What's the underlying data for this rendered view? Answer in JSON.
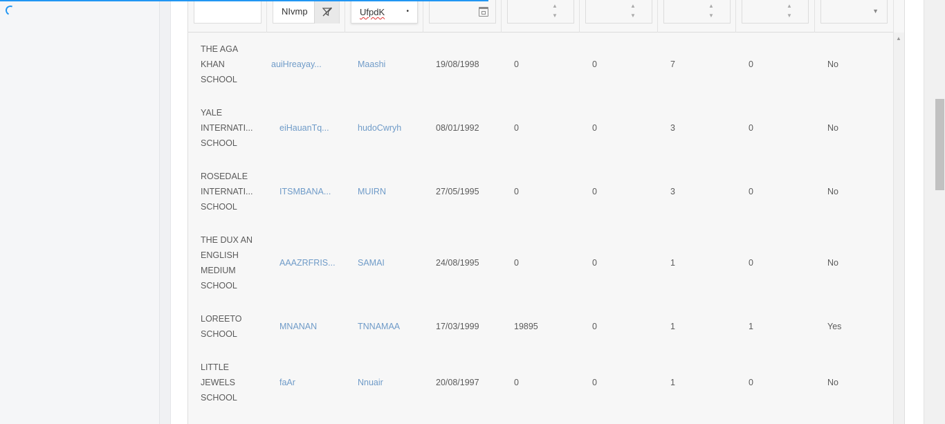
{
  "filters": {
    "col1_value": "",
    "col2_value": "NIvmp",
    "col3_value": "UfpdK",
    "col4_value": "",
    "col5_value": "",
    "col6_value": "",
    "col7_value": "",
    "col8_value": "",
    "col9_value": ""
  },
  "rows": [
    {
      "school": "THE AGA KHAN SCHOOL",
      "code": "auiHreayay...",
      "name": "Maashi",
      "date": "19/08/1998",
      "v1": "0",
      "v2": "0",
      "v3": "7",
      "v4": "0",
      "flag": "No"
    },
    {
      "school": "YALE INTERNATI... SCHOOL",
      "code": "eiHauanTq...",
      "name": "hudoCwryh",
      "date": "08/01/1992",
      "v1": "0",
      "v2": "0",
      "v3": "3",
      "v4": "0",
      "flag": "No"
    },
    {
      "school": "ROSEDALE INTERNATI... SCHOOL",
      "code": "ITSMBANA...",
      "name": "MUIRN",
      "date": "27/05/1995",
      "v1": "0",
      "v2": "0",
      "v3": "3",
      "v4": "0",
      "flag": "No"
    },
    {
      "school": "THE DUX AN ENGLISH MEDIUM SCHOOL",
      "code": "AAAZRFRIS...",
      "name": "SAMAI",
      "date": "24/08/1995",
      "v1": "0",
      "v2": "0",
      "v3": "1",
      "v4": "0",
      "flag": "No"
    },
    {
      "school": "LOREETO SCHOOL",
      "code": "MNANAN",
      "name": "TNNAMAA",
      "date": "17/03/1999",
      "v1": "19895",
      "v2": "0",
      "v3": "1",
      "v4": "1",
      "flag": "Yes"
    },
    {
      "school": "LITTLE JEWELS SCHOOL",
      "code": "faAr",
      "name": "Nnuair",
      "date": "20/08/1997",
      "v1": "0",
      "v2": "0",
      "v3": "1",
      "v4": "0",
      "flag": "No"
    }
  ],
  "icons": {
    "loading": "loading-spinner-icon",
    "filter_clear": "filter-clear-icon",
    "calendar": "calendar-icon",
    "spin": "spin-arrows-icon",
    "dropdown": "chevron-down-icon"
  },
  "colors": {
    "accent": "#2196f3",
    "link": "#6f9bc8"
  }
}
